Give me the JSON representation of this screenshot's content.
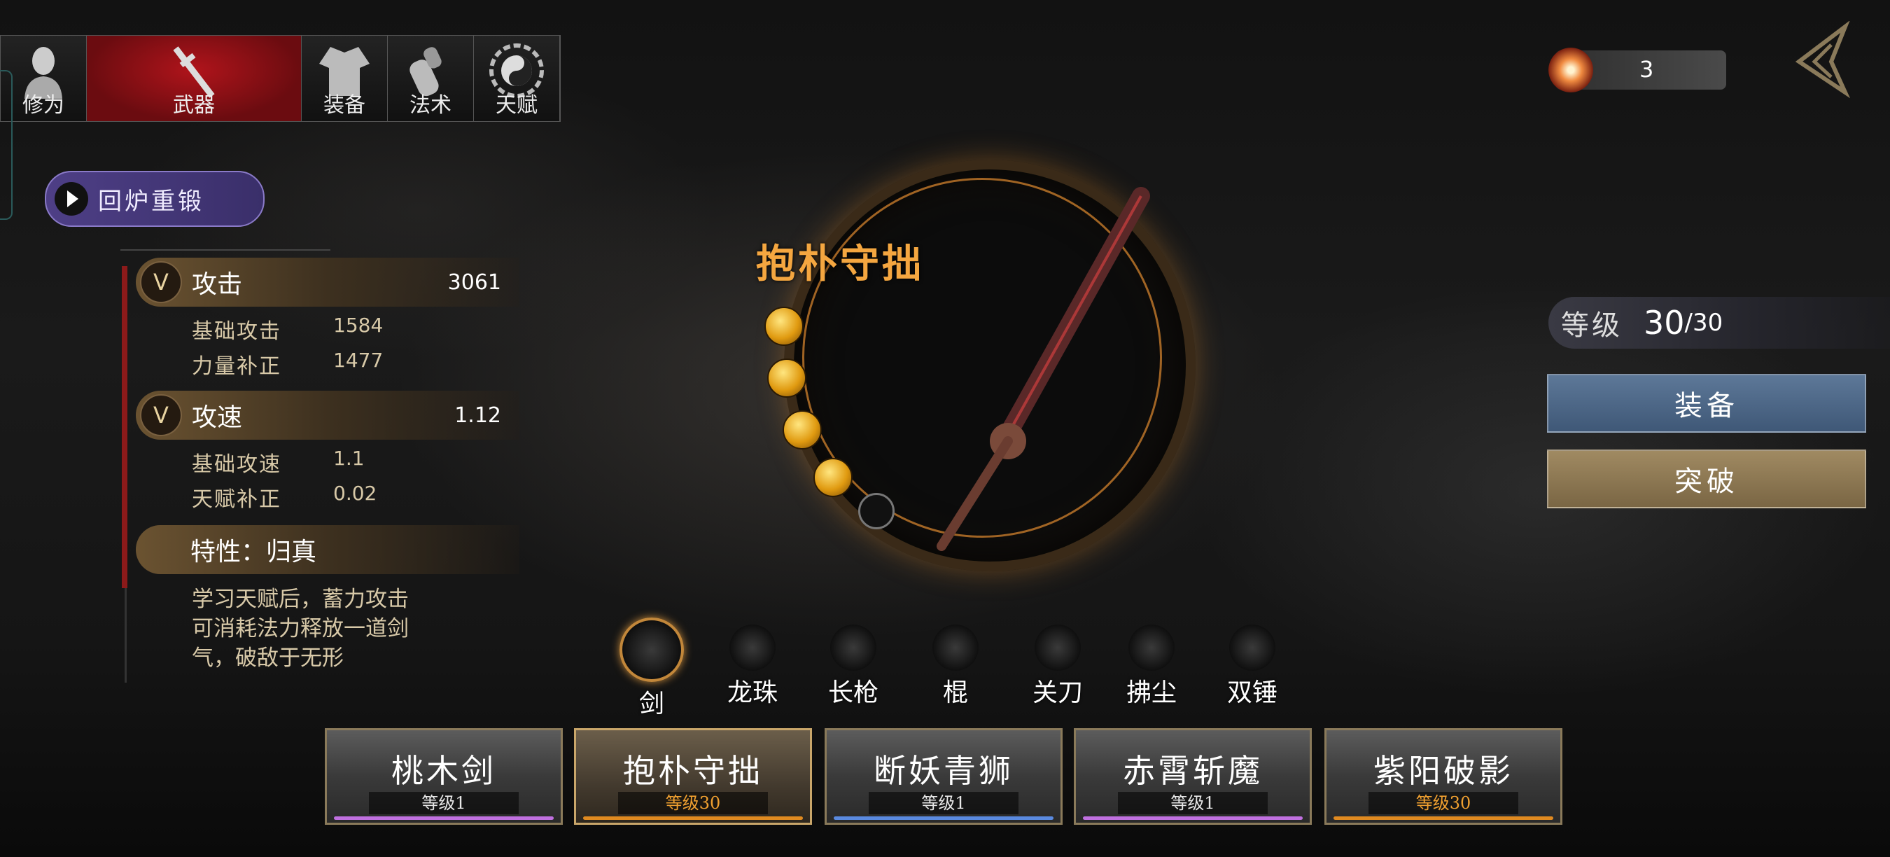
{
  "tabs": [
    {
      "label": "修为",
      "icon": "figure-icon",
      "active": false
    },
    {
      "label": "武器",
      "icon": "sword-icon",
      "active": true
    },
    {
      "label": "装备",
      "icon": "robe-icon",
      "active": false
    },
    {
      "label": "法术",
      "icon": "gourd-icon",
      "active": false
    },
    {
      "label": "天赋",
      "icon": "bagua-icon",
      "active": false
    }
  ],
  "reforge_label": "回炉重锻",
  "stats": {
    "attack": {
      "label": "攻击",
      "value": "3061",
      "rows": [
        {
          "k": "基础攻击",
          "v": "1584"
        },
        {
          "k": "力量补正",
          "v": "1477"
        }
      ]
    },
    "speed": {
      "label": "攻速",
      "value": "1.12",
      "rows": [
        {
          "k": "基础攻速",
          "v": "1.1"
        },
        {
          "k": "天赋补正",
          "v": "0.02"
        }
      ]
    },
    "trait": {
      "label": "特性：归真",
      "desc": "学习天赋后，蓄力攻击可消耗法力释放一道剑气，破敌于无形"
    }
  },
  "weapon": {
    "name": "抱朴守拙",
    "orbs_filled": 4,
    "orbs_total": 5
  },
  "currency": {
    "value": "3"
  },
  "level": {
    "label": "等级",
    "value": "30",
    "max": "/30"
  },
  "buttons": {
    "equip": "装备",
    "breakthrough": "突破"
  },
  "weapon_types": [
    {
      "label": "剑",
      "selected": true
    },
    {
      "label": "龙珠",
      "selected": false
    },
    {
      "label": "长枪",
      "selected": false
    },
    {
      "label": "棍",
      "selected": false
    },
    {
      "label": "关刀",
      "selected": false
    },
    {
      "label": "拂尘",
      "selected": false
    },
    {
      "label": "双锤",
      "selected": false
    }
  ],
  "weapons": [
    {
      "name": "桃木剑",
      "level": "等级1",
      "bar": "#c070e0",
      "selected": false,
      "gold": false
    },
    {
      "name": "抱朴守拙",
      "level": "等级30",
      "bar": "#e08a20",
      "selected": true,
      "gold": true
    },
    {
      "name": "断妖青狮",
      "level": "等级1",
      "bar": "#5a8ae0",
      "selected": false,
      "gold": false
    },
    {
      "name": "赤霄斩魔",
      "level": "等级1",
      "bar": "#c070e0",
      "selected": false,
      "gold": false
    },
    {
      "name": "紫阳破影",
      "level": "等级30",
      "bar": "#e08a20",
      "selected": false,
      "gold": true
    }
  ],
  "colors": {
    "accent_gold": "#f4a640",
    "tab_active": "#b0141b",
    "equip_btn": "#5d7898",
    "break_btn": "#a08a62"
  }
}
